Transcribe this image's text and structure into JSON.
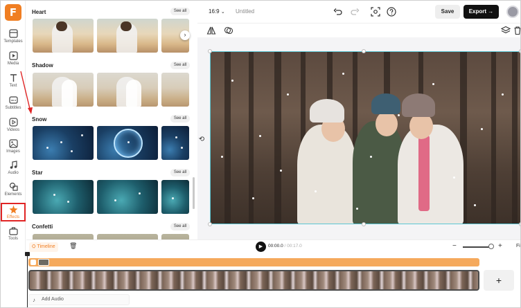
{
  "app": {
    "logo_letter": "F",
    "brand_color": "#f07e22"
  },
  "rail": {
    "items": [
      {
        "label": "Templates",
        "icon": "templates-icon"
      },
      {
        "label": "Media",
        "icon": "media-icon"
      },
      {
        "label": "Text",
        "icon": "text-icon"
      },
      {
        "label": "Subtitles",
        "icon": "subtitles-icon"
      },
      {
        "label": "Videos",
        "icon": "videos-icon"
      },
      {
        "label": "Images",
        "icon": "images-icon"
      },
      {
        "label": "Audio",
        "icon": "audio-icon"
      },
      {
        "label": "Elements",
        "icon": "elements-icon"
      },
      {
        "label": "Effects",
        "icon": "effects-icon",
        "active": true
      },
      {
        "label": "Tools",
        "icon": "tools-icon"
      }
    ]
  },
  "panel": {
    "sections": [
      {
        "title": "Heart",
        "see_all": "See all"
      },
      {
        "title": "Shadow",
        "see_all": "See all"
      },
      {
        "title": "Snow",
        "see_all": "See all"
      },
      {
        "title": "Star",
        "see_all": "See all"
      },
      {
        "title": "Confetti",
        "see_all": "See all"
      }
    ]
  },
  "topbar": {
    "ratio": "16:9",
    "title": "Untitled",
    "save_label": "Save",
    "export_label": "Export"
  },
  "timeline": {
    "label": "Timeline",
    "current_time": "00:00.0",
    "total_time": "/ 00:17.0",
    "fit_label": "Fi",
    "add_audio_label": "Add Audio",
    "add_clip_label": "+"
  },
  "colors": {
    "selection": "#5bc7d4",
    "annotation": "#e02424",
    "track_orange": "#f5a95c"
  }
}
